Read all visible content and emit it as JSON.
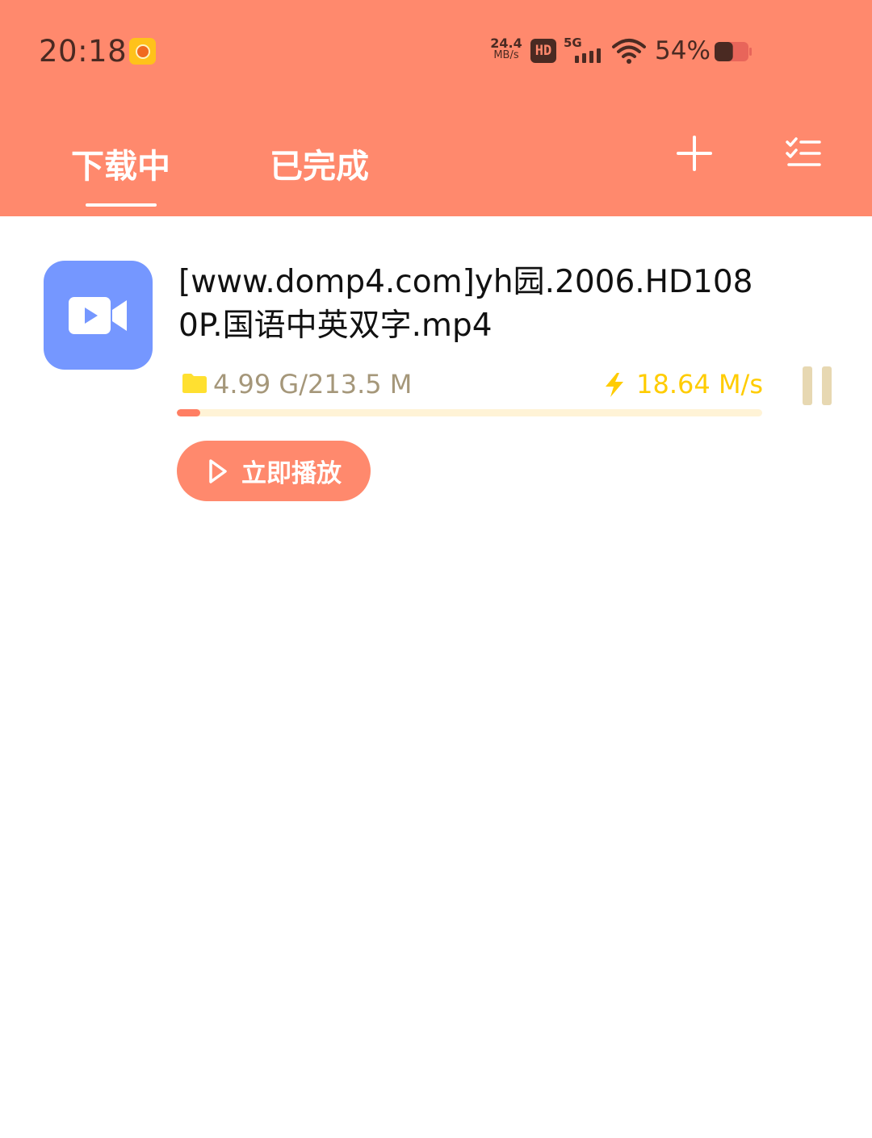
{
  "status_bar": {
    "time": "20:18",
    "net_speed_value": "24.4",
    "net_speed_unit": "MB/s",
    "hd_label": "HD",
    "network_type": "5G",
    "battery_percent": "54%",
    "battery_level": 0.54
  },
  "header": {
    "tabs": [
      {
        "label": "下载中",
        "active": true
      },
      {
        "label": "已完成",
        "active": false
      }
    ],
    "add_icon": "plus-icon",
    "list_icon": "checklist-icon"
  },
  "downloads": [
    {
      "title": "[www.domp4.com]yh园.2006.HD1080P.国语中英双字.mp4",
      "size_text": "4.99 G/213.5 M",
      "speed_text": "18.64 M/s",
      "progress": 0.04,
      "thumb_icon": "video-camera-icon",
      "play_label": "立即播放"
    }
  ],
  "colors": {
    "header_bg": "#FF896D",
    "thumb_bg": "#7597FF",
    "speed": "#FFCC00",
    "meta_text": "#A5977A",
    "progress_fill": "#FF7E63",
    "progress_track": "#FFF3D6"
  }
}
